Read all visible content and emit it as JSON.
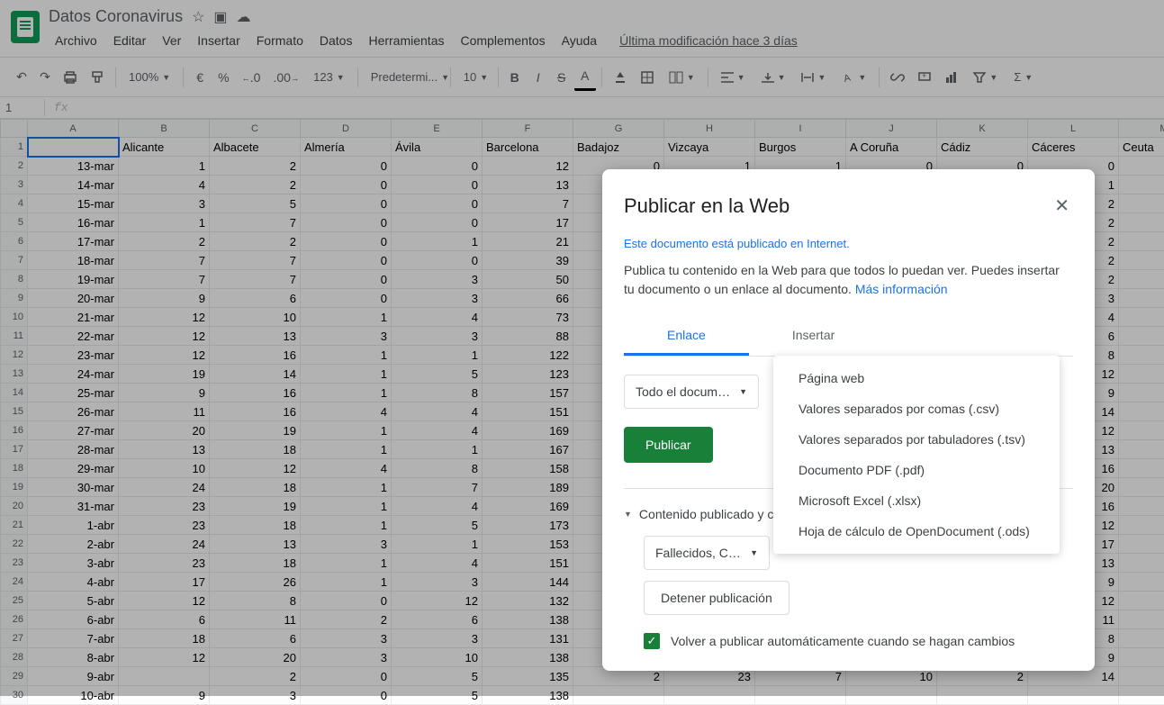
{
  "doc_title": "Datos Coronavirus",
  "last_modification": "Última modificación hace 3 días",
  "menubar": [
    "Archivo",
    "Editar",
    "Ver",
    "Insertar",
    "Formato",
    "Datos",
    "Herramientas",
    "Complementos",
    "Ayuda"
  ],
  "toolbar": {
    "zoom": "100%",
    "currency": "€",
    "percent": "%",
    "dec_less": ".0",
    "dec_more": ".00",
    "numfmt": "123",
    "font": "Predetermi...",
    "fontsize": "10"
  },
  "name_box": "1",
  "fx_label": "fx",
  "columns": [
    "A",
    "B",
    "C",
    "D",
    "E",
    "F",
    "G",
    "H",
    "I",
    "J",
    "K",
    "L",
    "M"
  ],
  "headers": [
    "",
    "Alicante",
    "Albacete",
    "Almería",
    "Ávila",
    "Barcelona",
    "Badajoz",
    "Vizcaya",
    "Burgos",
    "A Coruña",
    "Cádiz",
    "Cáceres",
    "Ceuta"
  ],
  "rows": [
    [
      "13-mar",
      "1",
      "2",
      "0",
      "0",
      "12",
      "0",
      "1",
      "1",
      "0",
      "0",
      "0",
      ""
    ],
    [
      "14-mar",
      "4",
      "2",
      "0",
      "0",
      "13",
      "",
      "",
      "",
      "",
      "",
      "1",
      ""
    ],
    [
      "15-mar",
      "3",
      "5",
      "0",
      "0",
      "7",
      "",
      "",
      "",
      "",
      "",
      "2",
      ""
    ],
    [
      "16-mar",
      "1",
      "7",
      "0",
      "0",
      "17",
      "",
      "",
      "",
      "",
      "",
      "2",
      ""
    ],
    [
      "17-mar",
      "2",
      "2",
      "0",
      "1",
      "21",
      "",
      "",
      "",
      "",
      "",
      "2",
      ""
    ],
    [
      "18-mar",
      "7",
      "7",
      "0",
      "0",
      "39",
      "",
      "",
      "",
      "",
      "",
      "2",
      ""
    ],
    [
      "19-mar",
      "7",
      "7",
      "0",
      "3",
      "50",
      "",
      "",
      "",
      "",
      "",
      "2",
      ""
    ],
    [
      "20-mar",
      "9",
      "6",
      "0",
      "3",
      "66",
      "",
      "",
      "",
      "",
      "",
      "3",
      ""
    ],
    [
      "21-mar",
      "12",
      "10",
      "1",
      "4",
      "73",
      "",
      "",
      "",
      "",
      "",
      "4",
      ""
    ],
    [
      "22-mar",
      "12",
      "13",
      "3",
      "3",
      "88",
      "",
      "",
      "",
      "",
      "",
      "6",
      ""
    ],
    [
      "23-mar",
      "12",
      "16",
      "1",
      "1",
      "122",
      "",
      "",
      "",
      "",
      "",
      "8",
      ""
    ],
    [
      "24-mar",
      "19",
      "14",
      "1",
      "5",
      "123",
      "",
      "",
      "",
      "",
      "",
      "12",
      ""
    ],
    [
      "25-mar",
      "9",
      "16",
      "1",
      "8",
      "157",
      "",
      "",
      "",
      "",
      "",
      "9",
      ""
    ],
    [
      "26-mar",
      "11",
      "16",
      "4",
      "4",
      "151",
      "",
      "",
      "",
      "",
      "",
      "14",
      ""
    ],
    [
      "27-mar",
      "20",
      "19",
      "1",
      "4",
      "169",
      "",
      "",
      "",
      "",
      "",
      "12",
      ""
    ],
    [
      "28-mar",
      "13",
      "18",
      "1",
      "1",
      "167",
      "",
      "",
      "",
      "",
      "",
      "13",
      ""
    ],
    [
      "29-mar",
      "10",
      "12",
      "4",
      "8",
      "158",
      "",
      "",
      "",
      "",
      "",
      "16",
      ""
    ],
    [
      "30-mar",
      "24",
      "18",
      "1",
      "7",
      "189",
      "",
      "",
      "",
      "",
      "",
      "20",
      ""
    ],
    [
      "31-mar",
      "23",
      "19",
      "1",
      "4",
      "169",
      "",
      "",
      "",
      "",
      "",
      "16",
      ""
    ],
    [
      "1-abr",
      "23",
      "18",
      "1",
      "5",
      "173",
      "",
      "",
      "",
      "",
      "",
      "12",
      ""
    ],
    [
      "2-abr",
      "24",
      "13",
      "3",
      "1",
      "153",
      "",
      "",
      "",
      "",
      "",
      "17",
      ""
    ],
    [
      "3-abr",
      "23",
      "18",
      "1",
      "4",
      "151",
      "",
      "",
      "",
      "",
      "",
      "13",
      ""
    ],
    [
      "4-abr",
      "17",
      "26",
      "1",
      "3",
      "144",
      "",
      "",
      "",
      "",
      "",
      "9",
      ""
    ],
    [
      "5-abr",
      "12",
      "8",
      "0",
      "12",
      "132",
      "",
      "",
      "",
      "",
      "",
      "12",
      ""
    ],
    [
      "6-abr",
      "6",
      "11",
      "2",
      "6",
      "138",
      "",
      "",
      "",
      "",
      "",
      "11",
      ""
    ],
    [
      "7-abr",
      "18",
      "6",
      "3",
      "3",
      "131",
      "",
      "",
      "",
      "",
      "",
      "8",
      ""
    ],
    [
      "8-abr",
      "12",
      "20",
      "3",
      "10",
      "138",
      "",
      "",
      "",
      "",
      "",
      "9",
      ""
    ],
    [
      "9-abr",
      "",
      "2",
      "0",
      "5",
      "135",
      "2",
      "23",
      "7",
      "10",
      "2",
      "14",
      ""
    ],
    [
      "10-abr",
      "9",
      "3",
      "0",
      "5",
      "138",
      "",
      "",
      "",
      "",
      "",
      "",
      ""
    ]
  ],
  "dialog": {
    "title": "Publicar en la Web",
    "published_notice": "Este documento está publicado en Internet.",
    "description": "Publica tu contenido en la Web para que todos lo puedan ver. Puedes insertar tu documento o un enlace al documento. ",
    "more_info": "Más información",
    "tab_link": "Enlace",
    "tab_insert": "Insertar",
    "doc_select": "Todo el documen…",
    "publish_btn": "Publicar",
    "section_title": "Contenido publicado y c",
    "sheets_select": "Fallecidos, Casos…",
    "stop_btn": "Detener publicación",
    "republish_label": "Volver a publicar automáticamente cuando se hagan cambios"
  },
  "format_menu": [
    "Página web",
    "Valores separados por comas (.csv)",
    "Valores separados por tabuladores (.tsv)",
    "Documento PDF (.pdf)",
    "Microsoft Excel (.xlsx)",
    "Hoja de cálculo de OpenDocument (.ods)"
  ]
}
